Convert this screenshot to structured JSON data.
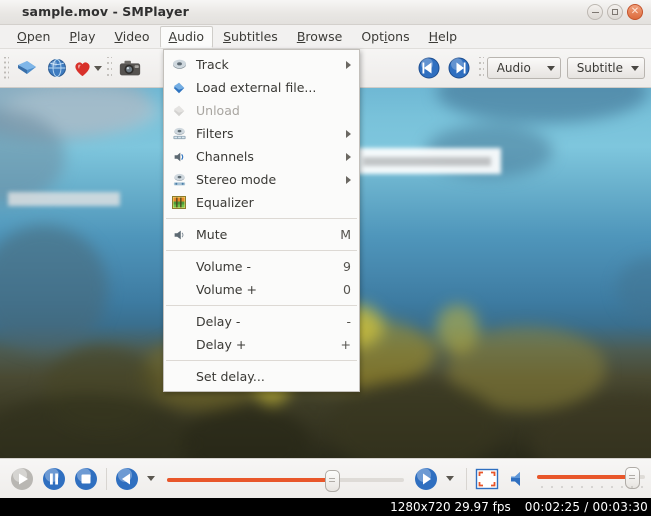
{
  "window": {
    "title": "sample.mov - SMPlayer",
    "controls": [
      {
        "name": "minimize-button",
        "glyph": "–"
      },
      {
        "name": "maximize-button",
        "glyph": "□"
      },
      {
        "name": "close-button",
        "glyph": "✕"
      }
    ]
  },
  "menubar": {
    "items": [
      {
        "label": "Open",
        "mnemonic": "O",
        "active": false
      },
      {
        "label": "Play",
        "mnemonic": "P",
        "active": false
      },
      {
        "label": "Video",
        "mnemonic": "V",
        "active": false
      },
      {
        "label": "Audio",
        "mnemonic": "A",
        "active": true
      },
      {
        "label": "Subtitles",
        "mnemonic": "S",
        "active": false
      },
      {
        "label": "Browse",
        "mnemonic": "B",
        "active": false
      },
      {
        "label": "Options",
        "mnemonic": "O",
        "active": false
      },
      {
        "label": "Help",
        "mnemonic": "H",
        "active": false
      }
    ]
  },
  "toolbar": {
    "buttons": [
      {
        "name": "open-file-icon",
        "tip": "Open file"
      },
      {
        "name": "open-url-globe-icon",
        "tip": "Open URL"
      },
      {
        "name": "favorites-heart-icon",
        "tip": "Favorites"
      },
      {
        "name": "screenshot-camera-icon",
        "tip": "Screenshot"
      },
      {
        "name": "previous-chapter-icon",
        "tip": "Previous"
      },
      {
        "name": "next-chapter-icon",
        "tip": "Next"
      }
    ],
    "audio_combo": "Audio",
    "subtitle_combo": "Subtitle"
  },
  "audio_menu": {
    "items": [
      {
        "label": "Track",
        "icon": "audio-track-icon",
        "accel": "",
        "submenu": true,
        "disabled": false,
        "separator_after": false
      },
      {
        "label": "Load external file...",
        "icon": "load-file-icon",
        "accel": "",
        "submenu": false,
        "disabled": false,
        "separator_after": false
      },
      {
        "label": "Unload",
        "icon": "unload-icon",
        "accel": "",
        "submenu": false,
        "disabled": true,
        "separator_after": false
      },
      {
        "label": "Filters",
        "icon": "filters-icon",
        "accel": "",
        "submenu": true,
        "disabled": false,
        "separator_after": false
      },
      {
        "label": "Channels",
        "icon": "channels-icon",
        "accel": "",
        "submenu": true,
        "disabled": false,
        "separator_after": false
      },
      {
        "label": "Stereo mode",
        "icon": "stereo-mode-icon",
        "accel": "",
        "submenu": true,
        "disabled": false,
        "separator_after": false
      },
      {
        "label": "Equalizer",
        "icon": "equalizer-icon",
        "accel": "",
        "submenu": false,
        "disabled": false,
        "separator_after": true
      },
      {
        "label": "Mute",
        "icon": "mute-icon",
        "accel": "M",
        "submenu": false,
        "disabled": false,
        "separator_after": true
      },
      {
        "label": "Volume -",
        "icon": "",
        "accel": "9",
        "submenu": false,
        "disabled": false,
        "separator_after": false
      },
      {
        "label": "Volume +",
        "icon": "",
        "accel": "0",
        "submenu": false,
        "disabled": false,
        "separator_after": true
      },
      {
        "label": "Delay -",
        "icon": "",
        "accel": "-",
        "submenu": false,
        "disabled": false,
        "separator_after": false
      },
      {
        "label": "Delay +",
        "icon": "",
        "accel": "+",
        "submenu": false,
        "disabled": false,
        "separator_after": true
      },
      {
        "label": "Set delay...",
        "icon": "",
        "accel": "",
        "submenu": false,
        "disabled": false,
        "separator_after": false
      }
    ]
  },
  "controls": {
    "buttons": [
      {
        "name": "play-button",
        "tip": "Play"
      },
      {
        "name": "pause-button",
        "tip": "Pause"
      },
      {
        "name": "stop-button",
        "tip": "Stop"
      },
      {
        "name": "rewind-button",
        "tip": "Rewind"
      },
      {
        "name": "forward-button",
        "tip": "Forward"
      },
      {
        "name": "fullscreen-button",
        "tip": "Fullscreen"
      },
      {
        "name": "mute-speaker-button",
        "tip": "Mute"
      }
    ],
    "seek_percent": 69,
    "volume_percent": 87
  },
  "statusbar": {
    "resolution_fps": "1280x720 29.97 fps",
    "time": "00:02:25 / 00:03:30"
  },
  "colors": {
    "accent_orange": "#e8562a",
    "menu_bg": "#fbfbfa",
    "chrome_bg": "#f2f1f0",
    "status_bg": "#000000",
    "water_top": "#7ec6dd",
    "water_mid": "#4687ad",
    "reef_dark": "#33321f"
  }
}
